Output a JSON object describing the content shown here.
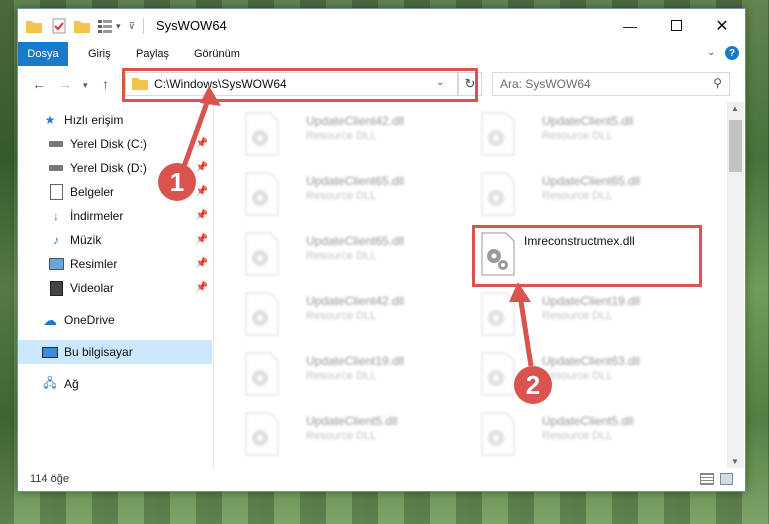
{
  "window": {
    "title": "SysWOW64",
    "ribbon_tabs": [
      "Dosya",
      "Giriş",
      "Paylaş",
      "Görünüm"
    ]
  },
  "address": {
    "path": "C:\\Windows\\SysWOW64",
    "search_placeholder": "Ara: SysWOW64"
  },
  "sidebar": {
    "items": [
      {
        "label": "Hızlı erişim",
        "icon": "star-icon"
      },
      {
        "label": "Yerel Disk (C:)",
        "icon": "drive-icon",
        "pinned": true
      },
      {
        "label": "Yerel Disk (D:)",
        "icon": "drive-icon",
        "pinned": true
      },
      {
        "label": "Belgeler",
        "icon": "documents-icon",
        "pinned": true
      },
      {
        "label": "İndirmeler",
        "icon": "downloads-icon",
        "pinned": true
      },
      {
        "label": "Müzik",
        "icon": "music-icon",
        "pinned": true
      },
      {
        "label": "Resimler",
        "icon": "pictures-icon",
        "pinned": true
      },
      {
        "label": "Videolar",
        "icon": "videos-icon",
        "pinned": true
      },
      {
        "label": "OneDrive",
        "icon": "cloud-icon"
      },
      {
        "label": "Bu bilgisayar",
        "icon": "computer-icon",
        "selected": true
      },
      {
        "label": "Ağ",
        "icon": "network-icon"
      }
    ]
  },
  "files": [
    {
      "name": "UpdateClient42.dll",
      "type": "Resource DLL"
    },
    {
      "name": "UpdateClient5.dll",
      "type": "Resource DLL"
    },
    {
      "name": "UpdateClient65.dll",
      "type": "Resource DLL"
    },
    {
      "name": "UpdateClient65.dll",
      "type": "Resource DLL"
    },
    {
      "name": "UpdateClient65.dll",
      "type": "Resource DLL"
    },
    {
      "name": "Imreconstructmex.dll",
      "type": ""
    },
    {
      "name": "UpdateClient42.dll",
      "type": "Resource DLL"
    },
    {
      "name": "UpdateClient19.dll",
      "type": "Resource DLL"
    },
    {
      "name": "UpdateClient19.dll",
      "type": "Resource DLL"
    },
    {
      "name": "UpdateClient63.dll",
      "type": "Resource DLL"
    },
    {
      "name": "UpdateClient5.dll",
      "type": "Resource DLL"
    },
    {
      "name": "UpdateClient5.dll",
      "type": "Resource DLL"
    }
  ],
  "status": {
    "count": "114 öğe"
  },
  "annotations": {
    "marker_1": "1",
    "marker_2": "2",
    "color": "#d9534f"
  },
  "colors": {
    "accent": "#1979ca",
    "selection": "#cce8ff"
  }
}
